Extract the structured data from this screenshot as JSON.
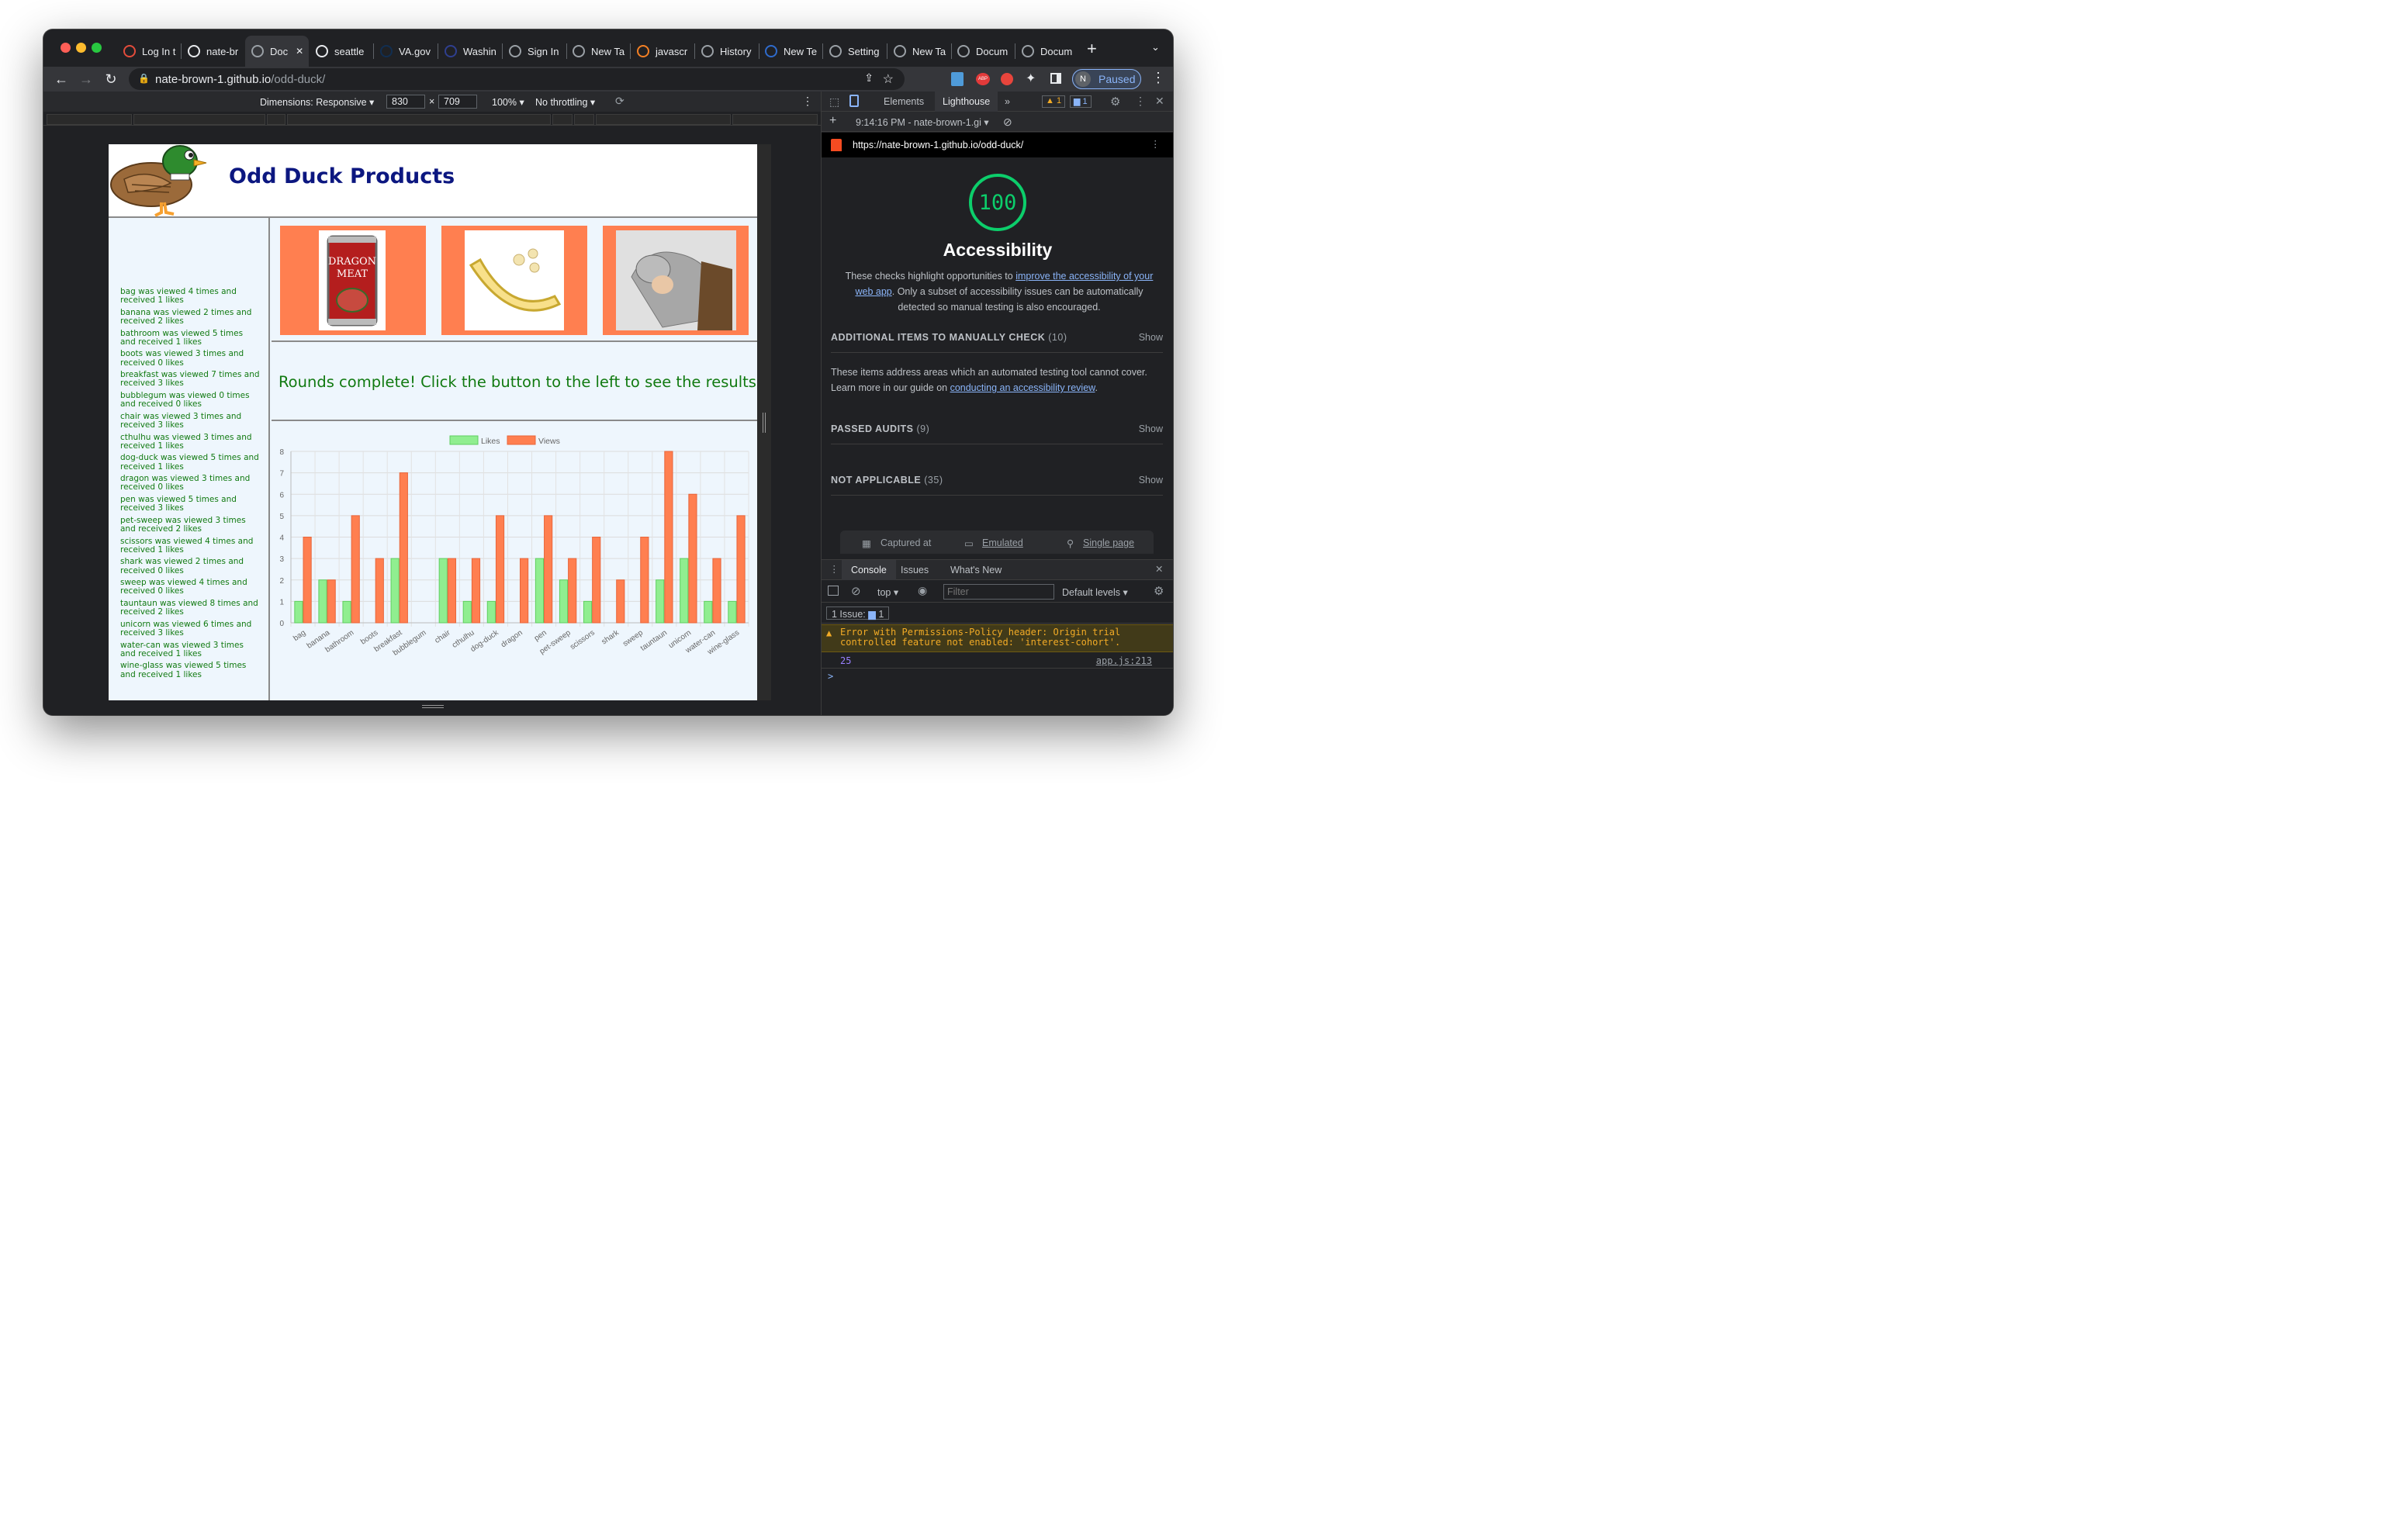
{
  "browser": {
    "tabs": [
      {
        "label": "Log In t",
        "icon": "log-in-icon"
      },
      {
        "label": "nate-br",
        "icon": "github-icon"
      },
      {
        "label": "Doc",
        "icon": "globe-icon",
        "active": true
      },
      {
        "label": "seattle",
        "icon": "github-icon"
      },
      {
        "label": "VA.gov",
        "icon": "va-icon"
      },
      {
        "label": "Washin",
        "icon": "washington-icon"
      },
      {
        "label": "Sign In",
        "icon": "globe-icon"
      },
      {
        "label": "New Ta",
        "icon": "chrome-icon"
      },
      {
        "label": "javascr",
        "icon": "stackoverflow-icon"
      },
      {
        "label": "History",
        "icon": "history-icon"
      },
      {
        "label": "New Te",
        "icon": "edge-icon"
      },
      {
        "label": "Setting",
        "icon": "gear-icon"
      },
      {
        "label": "New Ta",
        "icon": "chrome-icon"
      },
      {
        "label": "Docum",
        "icon": "globe-icon"
      },
      {
        "label": "Docum",
        "icon": "globe-icon"
      }
    ],
    "url_host": "nate-brown-1.github.io",
    "url_path": "/odd-duck/",
    "profile_initial": "N",
    "profile_status": "Paused",
    "extensions": [
      "download-extension-icon",
      "adblock-icon",
      "red-extension-icon",
      "puzzle-icon",
      "sidebar-icon"
    ]
  },
  "device_toolbar": {
    "dimensions_label": "Dimensions: Responsive",
    "width": "830",
    "times": "×",
    "height": "709",
    "zoom": "100%",
    "throttling": "No throttling"
  },
  "site": {
    "title": "Odd Duck Products",
    "message": "Rounds complete! Click the button to the left to see the results.",
    "products": [
      {
        "name": "dragon",
        "image_text": "DRAGON MEAT"
      },
      {
        "name": "banana"
      },
      {
        "name": "tauntaun"
      }
    ],
    "results": [
      "bag was viewed 4 times and received 1 likes",
      "banana was viewed 2 times and received 2 likes",
      "bathroom was viewed 5 times and received 1 likes",
      "boots was viewed 3 times and received 0 likes",
      "breakfast was viewed 7 times and received 3 likes",
      "bubblegum was viewed 0 times and received 0 likes",
      "chair was viewed 3 times and received 3 likes",
      "cthulhu was viewed 3 times and received 1 likes",
      "dog-duck was viewed 5 times and received 1 likes",
      "dragon was viewed 3 times and received 0 likes",
      "pen was viewed 5 times and received 3 likes",
      "pet-sweep was viewed 3 times and received 2 likes",
      "scissors was viewed 4 times and received 1 likes",
      "shark was viewed 2 times and received 0 likes",
      "sweep was viewed 4 times and received 0 likes",
      "tauntaun was viewed 8 times and received 2 likes",
      "unicorn was viewed 6 times and received 3 likes",
      "water-can was viewed 3 times and received 1 likes",
      "wine-glass was viewed 5 times and received 1 likes"
    ]
  },
  "chart_data": {
    "type": "bar",
    "categories": [
      "bag",
      "banana",
      "bathroom",
      "boots",
      "breakfast",
      "bubblegum",
      "chair",
      "cthulhu",
      "dog-duck",
      "dragon",
      "pen",
      "pet-sweep",
      "scissors",
      "shark",
      "sweep",
      "tauntaun",
      "unicorn",
      "water-can",
      "wine-glass"
    ],
    "series": [
      {
        "name": "Likes",
        "color": "#90ee90",
        "values": [
          1,
          2,
          1,
          0,
          3,
          0,
          3,
          1,
          1,
          0,
          3,
          2,
          1,
          0,
          0,
          2,
          3,
          1,
          1
        ]
      },
      {
        "name": "Views",
        "color": "#ff7f50",
        "values": [
          4,
          2,
          5,
          3,
          7,
          0,
          3,
          3,
          5,
          3,
          5,
          3,
          4,
          2,
          4,
          8,
          6,
          3,
          5
        ]
      }
    ],
    "ylim": [
      0,
      8
    ],
    "yticks": [
      "0",
      "1",
      "2",
      "3",
      "4",
      "5",
      "6",
      "7",
      "8"
    ],
    "grid": true,
    "legend": "top"
  },
  "devtools": {
    "tabs": [
      "Elements",
      "Lighthouse"
    ],
    "more": "»",
    "warnings": "1",
    "messages": "1",
    "report_time": "9:14:16 PM - nate-brown-1.gi",
    "report_url": "https://nate-brown-1.github.io/odd-duck/",
    "score": "100",
    "category": "Accessibility",
    "desc_pre": "These checks highlight opportunities to ",
    "desc_link": "improve the accessibility of your web app",
    "desc_post": ". Only a subset of accessibility issues can be automatically detected so manual testing is also encouraged.",
    "sections": [
      {
        "title": "ADDITIONAL ITEMS TO MANUALLY CHECK",
        "count": "(10)",
        "action": "Show"
      },
      {
        "title": "PASSED AUDITS",
        "count": "(9)",
        "action": "Show"
      },
      {
        "title": "NOT APPLICABLE",
        "count": "(35)",
        "action": "Show"
      }
    ],
    "manual_pre": "These items address areas which an automated testing tool cannot cover. Learn more in our guide on ",
    "manual_link": "conducting an accessibility review",
    "manual_post": ".",
    "footer": [
      "Captured at",
      "Emulated",
      "Single page"
    ],
    "drawer_tabs": [
      "Console",
      "Issues",
      "What's New"
    ],
    "context": "top",
    "filter_placeholder": "Filter",
    "levels": "Default levels",
    "issues_label": "1 Issue:",
    "issues_count": "1",
    "error_text": "Error with Permissions-Policy header: Origin trial controlled feature not enabled: 'interest-cohort'.",
    "log_value": "25",
    "log_source": "app.js:213",
    "prompt": ">"
  }
}
